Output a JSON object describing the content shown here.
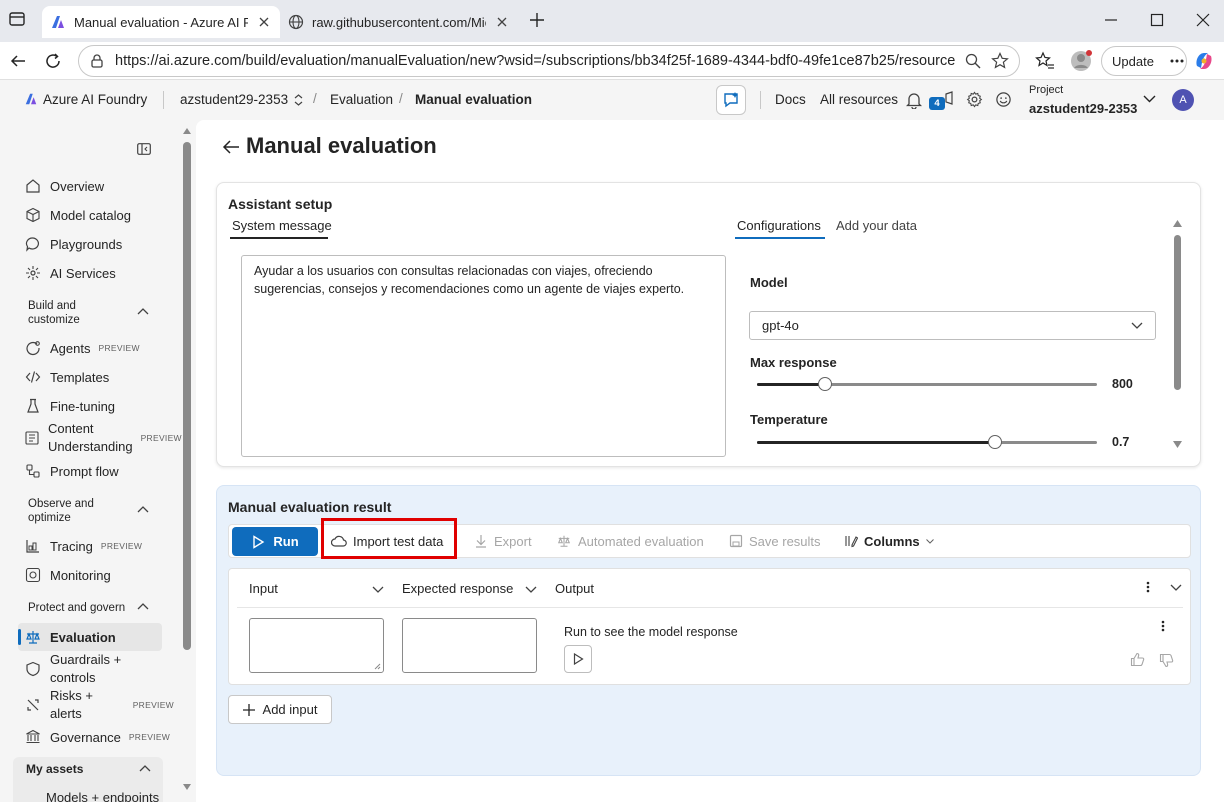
{
  "browser": {
    "tabs": [
      {
        "title": "Manual evaluation - Azure AI Foundry"
      },
      {
        "title": "raw.githubusercontent.com/Microsoft"
      }
    ],
    "url": "https://ai.azure.com/build/evaluation/manualEvaluation/new?wsid=/subscriptions/bb34f25f-1689-4344-bdf0-49fe1ce87b25/resourceGroups",
    "update_label": "Update"
  },
  "header": {
    "brand": "Azure AI Foundry",
    "project_switcher": "azstudent29-2353",
    "breadcrumb": [
      "Evaluation",
      "Manual evaluation"
    ],
    "docs": "Docs",
    "all_resources": "All resources",
    "notification_count": "4",
    "project_label": "Project",
    "project_name": "azstudent29-2353",
    "avatar_initial": "A"
  },
  "sidebar": {
    "top_items": [
      "Overview",
      "Model catalog",
      "Playgrounds",
      "AI Services"
    ],
    "sections": [
      {
        "title_lines": [
          "Build and",
          "customize"
        ]
      },
      {
        "title_lines": [
          "Observe and",
          "optimize"
        ]
      },
      {
        "title_lines": [
          "Protect and govern"
        ]
      }
    ],
    "build_items": [
      "Agents",
      "Templates",
      "Fine-tuning",
      "Content Understanding",
      "Prompt flow"
    ],
    "build_items_lines": {
      "content_1": "Content",
      "content_2": "Understanding"
    },
    "observe_items": [
      "Tracing",
      "Monitoring"
    ],
    "protect_items": [
      "Evaluation",
      "Guardrails +",
      "controls",
      "Risks +",
      "alerts",
      "Governance"
    ],
    "preview": "PREVIEW",
    "my_assets": "My assets",
    "models_endpoints": "Models + endpoints"
  },
  "page": {
    "title": "Manual evaluation",
    "assistant_setup": {
      "heading": "Assistant setup",
      "system_tab": "System message",
      "system_message_lines": [
        "Ayudar a los usuarios con consultas relacionadas con viajes, ofreciendo",
        "sugerencias, consejos y recomendaciones como un agente de viajes experto."
      ],
      "config_tabs": [
        "Configurations",
        "Add your data"
      ],
      "model_label": "Model",
      "model_value": "gpt-4o",
      "max_response_label": "Max response",
      "max_response_value": "800",
      "max_response_fraction": 0.2,
      "temperature_label": "Temperature",
      "temperature_value": "0.7",
      "temperature_fraction": 0.7
    },
    "result": {
      "heading": "Manual evaluation result",
      "toolbar": {
        "run": "Run",
        "import": "Import test data",
        "export": "Export",
        "automated": "Automated evaluation",
        "save": "Save results",
        "columns": "Columns"
      },
      "columns": [
        "Input",
        "Expected response",
        "Output"
      ],
      "output_placeholder": "Run to see the model response",
      "add_input": "Add input"
    }
  },
  "colors": {
    "accent": "#0f6cbd",
    "highlight": "#e00000",
    "result_bg": "#e8f1fb"
  }
}
